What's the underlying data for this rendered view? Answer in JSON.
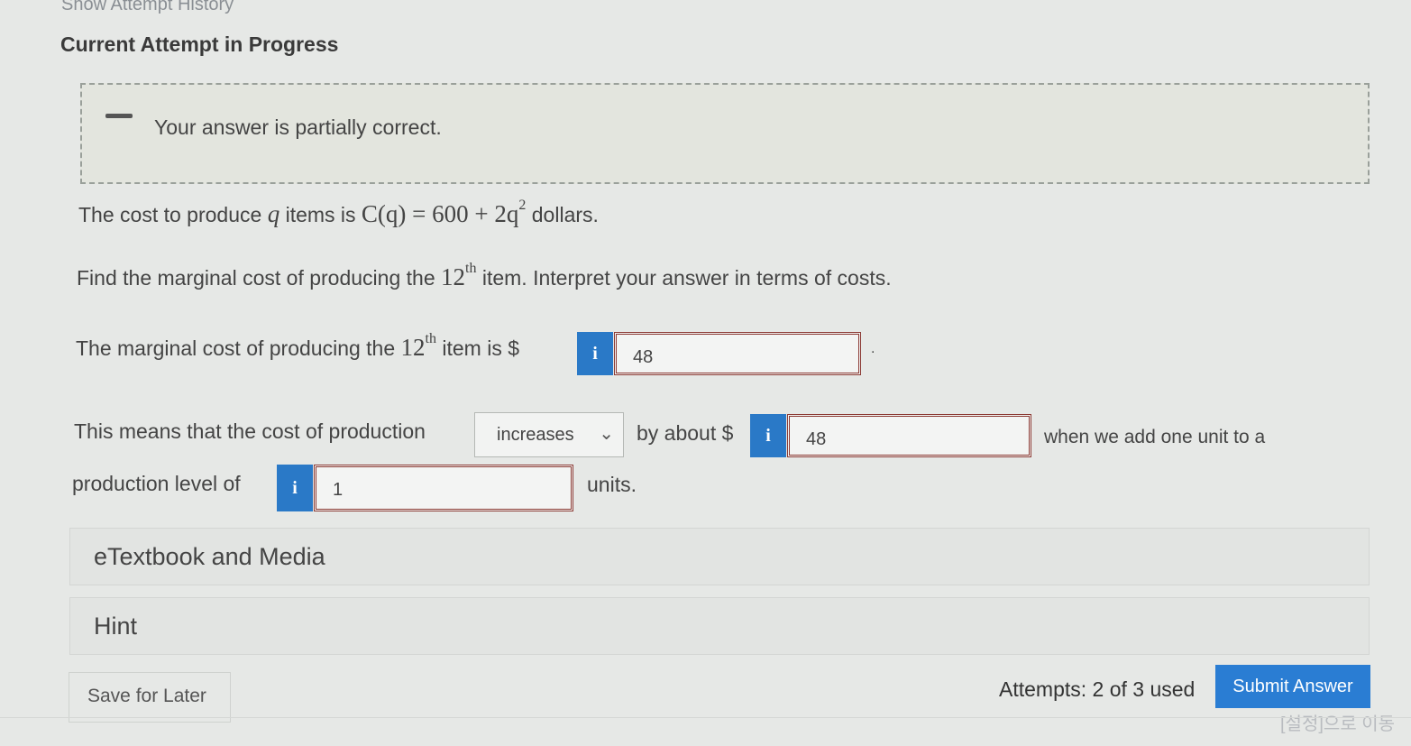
{
  "header": {
    "history_link": "Show Attempt History",
    "attempt_title": "Current Attempt in Progress"
  },
  "feedback": {
    "message": "Your answer is partially correct."
  },
  "question": {
    "line1_pre": "The cost to produce",
    "line1_var": "q",
    "line1_mid": "items is",
    "line1_func": "C(q) = 600 + 2q",
    "line1_exp": "2",
    "line1_post": "dollars.",
    "line2_pre": "Find the marginal cost of producing the",
    "line2_num": "12",
    "line2_sup": "th",
    "line2_post": "item. Interpret your answer in terms of costs.",
    "line3_pre": "The marginal cost of producing the",
    "line3_num": "12",
    "line3_sup": "th",
    "line3_post": "item is $",
    "line3_end": ".",
    "line4_pre": "This means that the cost of production",
    "line4_mid": "by about $",
    "line4_post": "when we add one unit to a",
    "line5_pre": "production level of",
    "line5_post": "units."
  },
  "answers": {
    "marginal_cost": "48",
    "direction": "increases",
    "increase_amount": "48",
    "production_level": "1"
  },
  "info_icon": "i",
  "panels": {
    "etextbook": "eTextbook and Media",
    "hint": "Hint"
  },
  "footer": {
    "save_label": "Save for Later",
    "attempts": "Attempts: 2 of 3 used",
    "submit_label": "Submit Answer",
    "korean_nav": "[설정]으로 이동"
  },
  "icons": {
    "partial": "dash-icon",
    "info": "info-icon",
    "dropdown": "chevron-down-icon"
  },
  "colors": {
    "submit": "#2a7dd3",
    "info_button": "#2a79c7",
    "answer_border": "#8b3a34"
  }
}
